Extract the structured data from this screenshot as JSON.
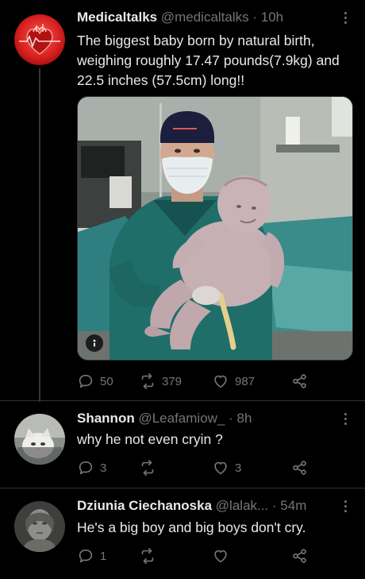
{
  "colors": {
    "background": "#000000",
    "text": "#e7e9ea",
    "muted": "#71767b",
    "divider": "#2f3336"
  },
  "tweets": [
    {
      "name": "Medicaltalks",
      "handle": "@medicaltalks",
      "time": "· 10h",
      "text": "The biggest baby born by natural birth, weighing roughly 17.47 pounds(7.9kg) and 22.5 inches (57.5cm) long!!",
      "avatar_icon": "heart-logo-icon",
      "replies": "50",
      "retweets": "379",
      "likes": "987"
    },
    {
      "name": "Shannon",
      "handle": "@Leafamiow_",
      "time": "· 8h",
      "text": "why he not even cryin ?",
      "avatar_icon": "cat-avatar-icon",
      "replies": "3",
      "retweets": "",
      "likes": "3"
    },
    {
      "name": "Dziunia Ciechanoska",
      "handle": "@lalak...",
      "time": "· 54m",
      "text": "He's a big boy and big boys don't cry.",
      "avatar_icon": "statue-avatar-icon",
      "replies": "1",
      "retweets": "",
      "likes": ""
    }
  ],
  "media": {
    "badge_icon": "alt-text-icon",
    "description_icon": "surgeon-holding-baby-photo"
  }
}
